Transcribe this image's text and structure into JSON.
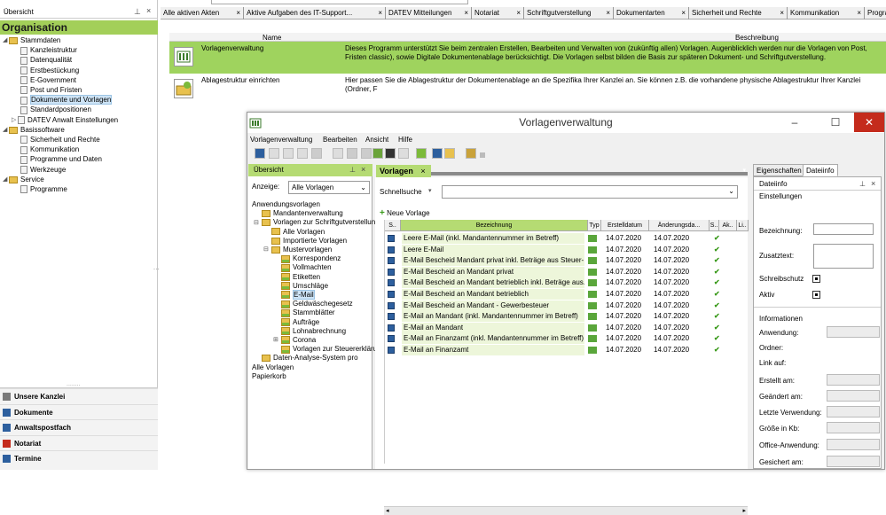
{
  "top_tabs": [
    {
      "label": "Alle aktiven Akten"
    },
    {
      "label": "Aktive Aufgaben des IT-Support..."
    },
    {
      "label": "DATEV Mitteilungen"
    },
    {
      "label": "Notariat"
    },
    {
      "label": "Schriftgutverstellung"
    },
    {
      "label": "Dokumentarten"
    },
    {
      "label": "Sicherheit und Rechte"
    },
    {
      "label": "Kommunikation"
    },
    {
      "label": "Progra"
    }
  ],
  "left_panel": {
    "header": "Übersicht",
    "section_title": "Organisation",
    "tree": [
      {
        "label": "Stammdaten",
        "level": 0
      },
      {
        "label": "Kanzleistruktur",
        "level": 1
      },
      {
        "label": "Datenqualität",
        "level": 1
      },
      {
        "label": "Erstbestückung",
        "level": 1
      },
      {
        "label": "E-Government",
        "level": 1
      },
      {
        "label": "Post und Fristen",
        "level": 1
      },
      {
        "label": "Dokumente und Vorlagen",
        "level": 1,
        "selected": true
      },
      {
        "label": "Standardpositionen",
        "level": 1
      },
      {
        "label": "DATEV Anwalt Einstellungen",
        "level": 1
      },
      {
        "label": "Basissoftware",
        "level": 0
      },
      {
        "label": "Sicherheit und Rechte",
        "level": 1
      },
      {
        "label": "Kommunikation",
        "level": 1
      },
      {
        "label": "Programme und Daten",
        "level": 1
      },
      {
        "label": "Werkzeuge",
        "level": 1
      },
      {
        "label": "Service",
        "level": 0
      },
      {
        "label": "Programme",
        "level": 1
      }
    ],
    "nav": [
      {
        "label": "Unsere Kanzlei"
      },
      {
        "label": "Dokumente"
      },
      {
        "label": "Anwaltspostfach"
      },
      {
        "label": "Notariat"
      },
      {
        "label": "Termine"
      }
    ]
  },
  "main_table": {
    "columns": [
      "Name",
      "Beschreibung"
    ],
    "rows": [
      {
        "name": "Vorlagenverwaltung",
        "description": "Dieses Programm unterstützt Sie beim zentralen Erstellen, Bearbeiten und Verwalten von (zukünftig allen) Vorlagen. Augenblicklich werden nur die Vorlagen von Post, Fristen classic), sowie Digitale Dokumentenablage berücksichtigt. Die Vorlagen selbst bilden die Basis zur späteren Dokument- und Schriftgutverstellung."
      },
      {
        "name": "Ablagestruktur einrichten",
        "description": "Hier passen Sie die Ablagestruktur der Dokumentenablage an die Spezifika Ihrer Kanzlei an. Sie können z.B. die vorhandene physische Ablagestruktur Ihrer Kanzlei (Ordner, F"
      }
    ]
  },
  "window": {
    "title": "Vorlagenverwaltung",
    "menu": [
      "Vorlagenverwaltung",
      "Bearbeiten",
      "Ansicht",
      "Hilfe"
    ],
    "overview": {
      "header": "Übersicht",
      "anzeige_label": "Anzeige:",
      "anzeige_value": "Alle Vorlagen",
      "tree": [
        {
          "label": "Anwendungsvorlagen"
        },
        {
          "label": "Mandantenverwaltung"
        },
        {
          "label": "Vorlagen zur Schriftgutverstellung"
        },
        {
          "label": "Alle Vorlagen"
        },
        {
          "label": "Importierte Vorlagen"
        },
        {
          "label": "Mustervorlagen"
        },
        {
          "label": "Korrespondenz"
        },
        {
          "label": "Vollmachten"
        },
        {
          "label": "Etiketten"
        },
        {
          "label": "Umschläge"
        },
        {
          "label": "E-Mail"
        },
        {
          "label": "Geldwäschegesetz"
        },
        {
          "label": "Stammblätter"
        },
        {
          "label": "Aufträge"
        },
        {
          "label": "Lohnabrechnung"
        },
        {
          "label": "Corona"
        },
        {
          "label": "Vorlagen zur Steuererklärung"
        },
        {
          "label": "Daten-Analyse-System pro"
        },
        {
          "label": "Alle Vorlagen"
        },
        {
          "label": "Papierkorb"
        }
      ]
    },
    "vorlagen_tab": "Vorlagen",
    "schnellsuche_label": "Schnellsuche",
    "neue_vorlage": "Neue Vorlage",
    "grid_columns": [
      "S..",
      "Bezeichnung",
      "Typ",
      "Erstelldatum",
      "Änderungsda...",
      "S..",
      "Ak..",
      "Li.."
    ],
    "grid_rows": [
      {
        "bezeichnung": "Leere E-Mail (inkl. Mandantennummer im Betreff)",
        "erstellt": "14.07.2020",
        "geaendert": "14.07.2020"
      },
      {
        "bezeichnung": "Leere E-Mail",
        "erstellt": "14.07.2020",
        "geaendert": "14.07.2020"
      },
      {
        "bezeichnung": "E-Mail Bescheid Mandant privat inkl. Beträge aus Steuer-...",
        "erstellt": "14.07.2020",
        "geaendert": "14.07.2020"
      },
      {
        "bezeichnung": "E-Mail Bescheid an Mandant privat",
        "erstellt": "14.07.2020",
        "geaendert": "14.07.2020"
      },
      {
        "bezeichnung": "E-Mail Bescheid an Mandant betrieblich inkl. Beträge aus...",
        "erstellt": "14.07.2020",
        "geaendert": "14.07.2020"
      },
      {
        "bezeichnung": "E-Mail Bescheid an Mandant betrieblich",
        "erstellt": "14.07.2020",
        "geaendert": "14.07.2020"
      },
      {
        "bezeichnung": "E-Mail Bescheid an Mandant - Gewerbesteuer",
        "erstellt": "14.07.2020",
        "geaendert": "14.07.2020"
      },
      {
        "bezeichnung": "E-Mail an Mandant (inkl. Mandantennummer im Betreff)",
        "erstellt": "14.07.2020",
        "geaendert": "14.07.2020"
      },
      {
        "bezeichnung": "E-Mail an Mandant",
        "erstellt": "14.07.2020",
        "geaendert": "14.07.2020"
      },
      {
        "bezeichnung": "E-Mail an Finanzamt (inkl. Mandantennummer im Betreff)",
        "erstellt": "14.07.2020",
        "geaendert": "14.07.2020"
      },
      {
        "bezeichnung": "E-Mail an Finanzamt",
        "erstellt": "14.07.2020",
        "geaendert": "14.07.2020"
      }
    ],
    "right_tabs": [
      "Eigenschaften",
      "Dateiinfo"
    ],
    "right_panel": {
      "header": "Dateiinfo",
      "einstellungen": "Einstellungen",
      "bezeichnung": "Bezeichnung:",
      "zusatztext": "Zusatztext:",
      "schreibschutz": "Schreibschutz",
      "aktiv": "Aktiv",
      "informationen": "Informationen",
      "anwendung": "Anwendung:",
      "ordner": "Ordner:",
      "link_auf": "Link auf:",
      "erstellt_am": "Erstellt am:",
      "geaendert_am": "Geändert am:",
      "letzte_verwendung": "Letzte Verwendung:",
      "groesse": "Größe in Kb:",
      "office": "Office-Anwendung:",
      "gesichert": "Gesichert am:"
    }
  },
  "colors": {
    "accent_green": "#a3cf59",
    "row_green": "#9fd35e",
    "close_red": "#c42b1c"
  }
}
